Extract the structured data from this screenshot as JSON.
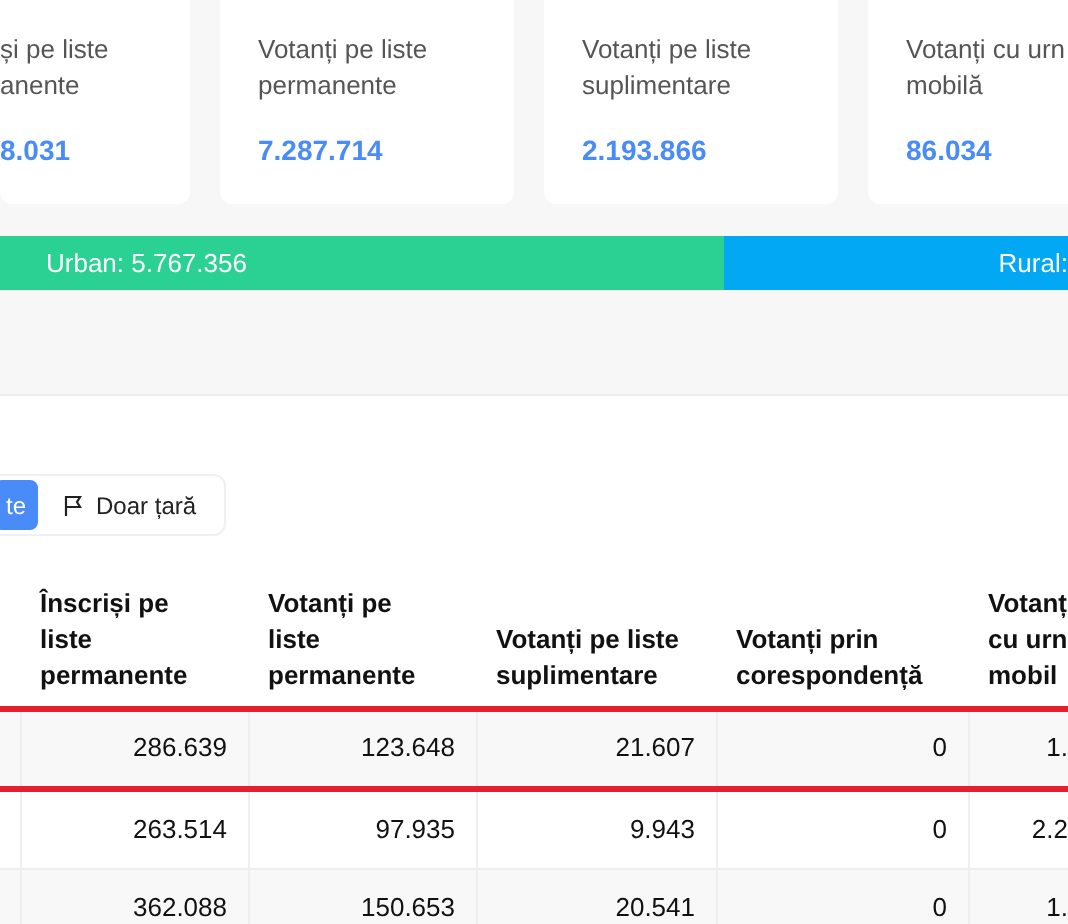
{
  "cards": [
    {
      "label_lines": [
        "și pe liste",
        "anente"
      ],
      "value": "8.031"
    },
    {
      "label_lines": [
        "Votanți pe liste",
        "permanente"
      ],
      "value": "7.287.714"
    },
    {
      "label_lines": [
        "Votanți pe liste",
        "suplimentare"
      ],
      "value": "2.193.866"
    },
    {
      "label_lines": [
        "Votanți cu urn",
        "mobilă"
      ],
      "value": "86.034"
    }
  ],
  "split_bar": {
    "segments": [
      {
        "label": "Urban: 5.767.356",
        "level": 0.678,
        "color": "#2bd192"
      },
      {
        "label": "Rural:",
        "level": 0.322,
        "color": "#02a8f3"
      }
    ]
  },
  "filter": [
    {
      "label": "te",
      "kind": "text",
      "selected": true
    },
    {
      "label": "Doar țară",
      "kind": "flag",
      "selected": false
    }
  ],
  "table": {
    "columns": [
      {},
      {
        "lines": [
          "Înscriși pe",
          "liste",
          "permanente"
        ]
      },
      {
        "lines": [
          "Votanți pe",
          "liste",
          "permanente"
        ]
      },
      {
        "lines": [
          "Votanți pe liste",
          "suplimentare"
        ]
      },
      {
        "lines": [
          "Votanți prin",
          "corespondență"
        ]
      },
      {
        "lines": [
          "Votanț",
          "cu urn",
          "mobil"
        ]
      }
    ],
    "rows": [
      {
        "highlighted": true,
        "cells": [
          "",
          "286.639",
          "123.648",
          "21.607",
          "0",
          "1."
        ]
      },
      {
        "highlighted": false,
        "cells": [
          "",
          "263.514",
          "97.935",
          "9.943",
          "0",
          "2.2"
        ]
      },
      {
        "highlighted": false,
        "cells": [
          "",
          "362.088",
          "150.653",
          "20.541",
          "0",
          "1."
        ]
      }
    ]
  }
}
